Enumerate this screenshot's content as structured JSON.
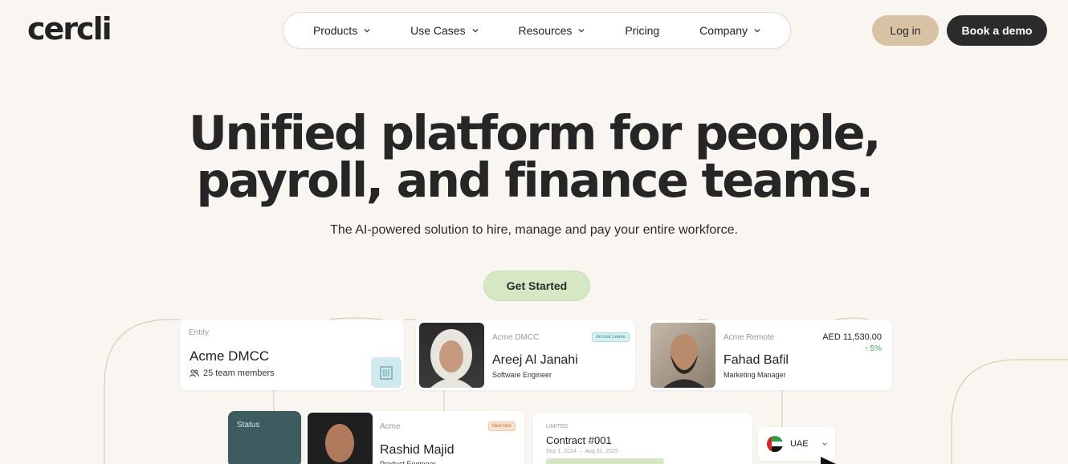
{
  "header": {
    "logo": "cercli",
    "nav": [
      "Products",
      "Use Cases",
      "Resources",
      "Pricing",
      "Company"
    ],
    "login_label": "Log in",
    "demo_label": "Book a demo"
  },
  "hero": {
    "title_line1": "Unified platform for people,",
    "title_line2": "payroll, and finance teams.",
    "subtitle": "The AI-powered solution to hire, manage and pay your entire workforce.",
    "cta_label": "Get Started"
  },
  "cards": {
    "entity": {
      "label": "Entity",
      "name": "Acme DMCC",
      "members": "25 team members"
    },
    "areej": {
      "company": "Acme DMCC",
      "badge": "Annual Leave",
      "name": "Areej Al Janahi",
      "role": "Software Engineer"
    },
    "fahad": {
      "company": "Acme Remote",
      "name": "Fahad Bafil",
      "role": "Marketing Manager",
      "amount": "AED 11,530.00",
      "change": "5%"
    },
    "status": {
      "label": "Status"
    },
    "rashid": {
      "company": "Acme",
      "badge": "New hire",
      "name": "Rashid Majid",
      "role": "Product Engineer"
    },
    "contract": {
      "label": "LIMITED",
      "title": "Contract #001",
      "dates": "Sep 1, 2024 → Aug 31, 2025"
    },
    "country": {
      "name": "UAE"
    }
  },
  "colors": {
    "accent_green": "#d5e8c3",
    "login_tan": "#d8c2a4",
    "dark": "#2b2b2b",
    "background": "#f9f5f1"
  }
}
